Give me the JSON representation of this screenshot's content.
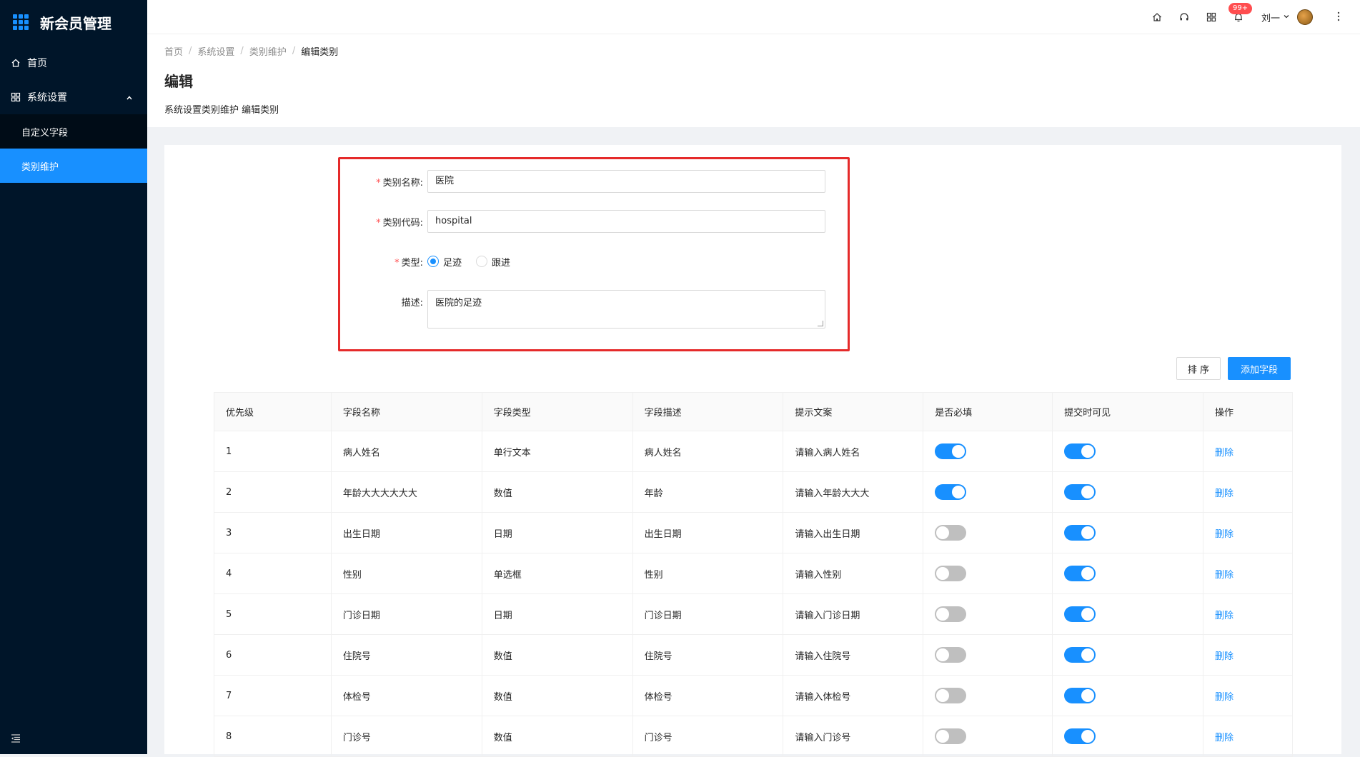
{
  "app": {
    "title": "新会员管理"
  },
  "sidebar": {
    "items": [
      {
        "label": "首页",
        "icon": "home-icon"
      },
      {
        "label": "系统设置",
        "icon": "settings-icon"
      }
    ],
    "submenu": [
      {
        "label": "自定义字段",
        "active": false
      },
      {
        "label": "类别维护",
        "active": true
      }
    ]
  },
  "header": {
    "badge": "99+",
    "user_name": "刘一"
  },
  "breadcrumb": {
    "items": [
      "首页",
      "系统设置",
      "类别维护"
    ],
    "current": "编辑类别"
  },
  "page": {
    "title": "编辑",
    "description": "系统设置类别维护 编辑类别"
  },
  "form": {
    "name_label": "类别名称:",
    "name_value": "医院",
    "code_label": "类别代码:",
    "code_value": "hospital",
    "type_label": "类型:",
    "type_options": [
      "足迹",
      "跟进"
    ],
    "type_selected": "足迹",
    "desc_label": "描述:",
    "desc_value": "医院的足迹"
  },
  "actions": {
    "sort_label": "排 序",
    "add_label": "添加字段"
  },
  "table": {
    "columns": [
      "优先级",
      "字段名称",
      "字段类型",
      "字段描述",
      "提示文案",
      "是否必填",
      "提交时可见",
      "操作"
    ],
    "rows": [
      {
        "priority": "1",
        "name": "病人姓名",
        "type": "单行文本",
        "desc": "病人姓名",
        "hint": "请输入病人姓名",
        "required": true,
        "visible": true,
        "action": "删除"
      },
      {
        "priority": "2",
        "name": "年龄大大大大大大",
        "type": "数值",
        "desc": "年龄",
        "hint": "请输入年龄大大大",
        "required": true,
        "visible": true,
        "action": "删除"
      },
      {
        "priority": "3",
        "name": "出生日期",
        "type": "日期",
        "desc": "出生日期",
        "hint": "请输入出生日期",
        "required": false,
        "visible": true,
        "action": "删除"
      },
      {
        "priority": "4",
        "name": "性别",
        "type": "单选框",
        "desc": "性别",
        "hint": "请输入性别",
        "required": false,
        "visible": true,
        "action": "删除"
      },
      {
        "priority": "5",
        "name": "门诊日期",
        "type": "日期",
        "desc": "门诊日期",
        "hint": "请输入门诊日期",
        "required": false,
        "visible": true,
        "action": "删除"
      },
      {
        "priority": "6",
        "name": "住院号",
        "type": "数值",
        "desc": "住院号",
        "hint": "请输入住院号",
        "required": false,
        "visible": true,
        "action": "删除"
      },
      {
        "priority": "7",
        "name": "体检号",
        "type": "数值",
        "desc": "体检号",
        "hint": "请输入体检号",
        "required": false,
        "visible": true,
        "action": "删除"
      },
      {
        "priority": "8",
        "name": "门诊号",
        "type": "数值",
        "desc": "门诊号",
        "hint": "请输入门诊号",
        "required": false,
        "visible": true,
        "action": "删除"
      }
    ]
  },
  "colors": {
    "primary": "#1890ff",
    "sidebar_bg": "#001529",
    "highlight_border": "#e52a2a",
    "switch_off": "#bfbfbf"
  }
}
